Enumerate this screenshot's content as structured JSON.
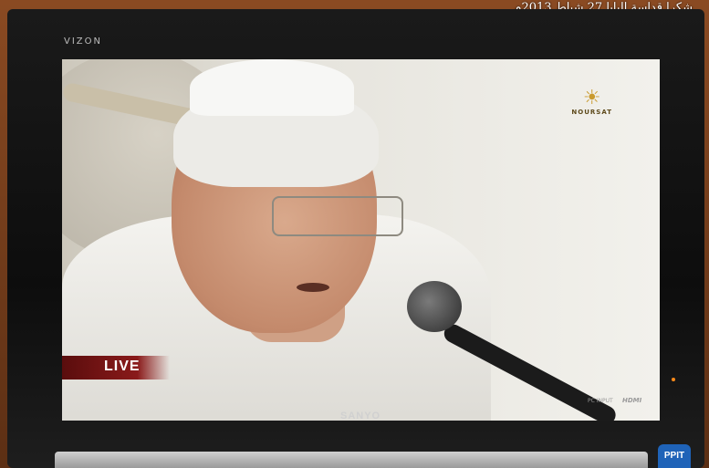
{
  "photo": {
    "caption": "شكرا قداسة البابا 27 شباط 2013م"
  },
  "tv": {
    "bezel_brand": "VIZON",
    "maker": "SANYO",
    "pc_input_label": "PC INPUT",
    "hdmi_label": "HDMI",
    "sticker_text": "PPIT"
  },
  "broadcast": {
    "live_label": "LIVE",
    "channel_logo_text": "NOURSAT"
  },
  "colors": {
    "live_badge": "#8a1a1a",
    "logo_gold": "#c99a2e",
    "bezel": "#111111"
  }
}
